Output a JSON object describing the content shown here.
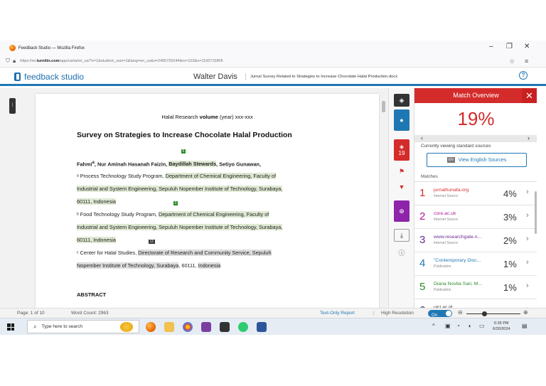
{
  "browser": {
    "window_title": "Feedback Studio — Mozilla Firefox",
    "url_prefix": "https://ev.",
    "url_domain": "turnitin.com",
    "url_rest": "/app/carta/en_us/?s=1&student_user=1&lang=en_us&o=2405726244&ro=103&u=1165715806"
  },
  "header": {
    "logo": "feedback studio",
    "student": "Walter Davis",
    "document_title": "Jurnal Survey Related to Strategies to Increase Chocolate Halal Production.docx"
  },
  "document": {
    "journal_line_pre": "Halal Research ",
    "journal_line_bold": "volume",
    "journal_line_post": " (year) xxx-xxx",
    "title": "Survey on Strategies to Increase Chocolate Halal Production",
    "authors_pre": "Fahmi",
    "authors_mid": ", Nur Aminah Hasanah Faizin, ",
    "authors_hl": "Baydillah Stewards",
    "authors_post": ", Setiyo Gunawan,",
    "aff_a_pre": "ᵃ Process Technology Study Program, ",
    "aff_a_hl1": "Department of Chemical Engineering, Faculty of",
    "aff_a_hl2": "Industrial and System Engineering, Sepuluh Nopember Institute of Technology, Surabaya,",
    "aff_a_hl3": "60111, Indonesia",
    "aff_b_pre": "ᵇ Food Technology Study Program, ",
    "aff_b_hl1": "Department of Chemical Engineering, Faculty of",
    "aff_b_hl2": "Industrial and System Engineering, Sepuluh Nopember Institute of Technology, Surabaya,",
    "aff_b_hl3": "60111, Indonesia",
    "aff_c_pre": "ᶜ Center for Halal Studies, ",
    "aff_c_hl1": "Directorate of Research and Community Service, Sepuluh",
    "aff_c_hl2": "Nopember Institute of Technology, Surabaya",
    "aff_c_mid": ", 60111, ",
    "aff_c_hl3": "Indonesia",
    "markers": [
      "5",
      "3",
      "12"
    ],
    "abstract": "ABSTRACT"
  },
  "toolbar": {
    "score": "19"
  },
  "panel": {
    "title": "Match Overview",
    "percent": "19%",
    "viewing": "Currently viewing standard sources",
    "en_badge": "EN",
    "english_btn": "View English Sources",
    "matches_label": "Matches",
    "matches": [
      {
        "n": "1",
        "source": "jurnalhunafa.org",
        "type": "Internet Source",
        "pct": "4%",
        "color": "#d42b2b"
      },
      {
        "n": "2",
        "source": "core.ac.uk",
        "type": "Internet Source",
        "pct": "3%",
        "color": "#b0179a"
      },
      {
        "n": "3",
        "source": "www.researchgate.n...",
        "type": "Internet Source",
        "pct": "2%",
        "color": "#6a2c91"
      },
      {
        "n": "4",
        "source": "\"Contemporary Disc...",
        "type": "Publication",
        "pct": "1%",
        "color": "#1f78b4"
      },
      {
        "n": "5",
        "source": "Diana Novita Sari, M...",
        "type": "Publication",
        "pct": "1%",
        "color": "#2a8a2a"
      },
      {
        "n": "6",
        "source": "uici.ac.id",
        "type": "",
        "pct": "1%",
        "color": "#333333"
      }
    ]
  },
  "statusbar": {
    "page": "Page: 1 of 10",
    "words": "Word Count: 2963",
    "text_only": "Text-Only Report",
    "high_res": "High Resolution",
    "toggle": "On"
  },
  "taskbar": {
    "search_placeholder": "Type here to search",
    "time": "6:35 PM",
    "date": "6/20/2024"
  }
}
